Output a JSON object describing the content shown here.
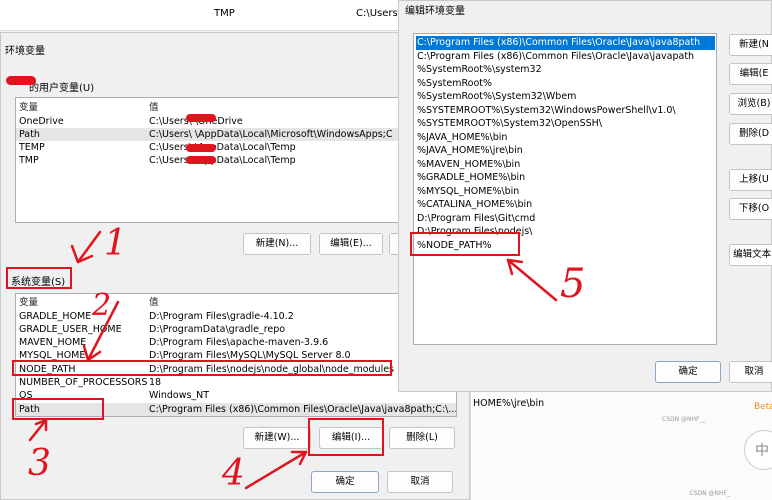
{
  "background": {
    "top_row_value": "TMP",
    "top_row_path": "C:\\Users\\",
    "top_left_text": "环境变量",
    "right_fragment": "HOME%\\jre\\bin",
    "watermark": "CSDN @NHF_",
    "watermark2": "CSDN @NHF__",
    "beta_text": "Beta",
    "circle_text": "中"
  },
  "env_dialog": {
    "title": "环境变量",
    "user_group_label": "的用户变量(U)",
    "columns": {
      "name": "变量",
      "value": "值"
    },
    "user_vars": [
      {
        "name": "OneDrive",
        "value": "C:\\Users\\      \\OneDrive"
      },
      {
        "name": "Path",
        "value": "C:\\Users\\      \\AppData\\Local\\Microsoft\\WindowsApps;C"
      },
      {
        "name": "TEMP",
        "value": "C:\\Users\\      \\AppData\\Local\\Temp"
      },
      {
        "name": "TMP",
        "value": "C:\\Users\\      \\AppData\\Local\\Temp"
      }
    ],
    "user_buttons": {
      "new": "新建(N)...",
      "edit": "编辑(E)..."
    },
    "system_group_label": "系统变量(S)",
    "system_vars": [
      {
        "name": "GRADLE_HOME",
        "value": "D:\\Program Files\\gradle-4.10.2"
      },
      {
        "name": "GRADLE_USER_HOME",
        "value": "D:\\ProgramData\\gradle_repo"
      },
      {
        "name": "MAVEN_HOME",
        "value": "D:\\Program Files\\apache-maven-3.9.6"
      },
      {
        "name": "MYSQL_HOME",
        "value": "D:\\Program Files\\MySQL\\MySQL Server 8.0"
      },
      {
        "name": "NODE_PATH",
        "value": "D:\\Program Files\\nodejs\\node_global\\node_modules"
      },
      {
        "name": "NUMBER_OF_PROCESSORS",
        "value": "18"
      },
      {
        "name": "OS",
        "value": "Windows_NT"
      },
      {
        "name": "Path",
        "value": "C:\\Program Files (x86)\\Common Files\\Oracle\\Java\\java8path;C:\\..."
      }
    ],
    "system_buttons": {
      "new": "新建(W)...",
      "edit": "编辑(I)...",
      "delete": "删除(L)"
    },
    "ok": "确定",
    "cancel": "取消"
  },
  "edit_dialog": {
    "title": "编辑环境变量",
    "items": [
      "C:\\Program Files (x86)\\Common Files\\Oracle\\Java\\java8path",
      "C:\\Program Files (x86)\\Common Files\\Oracle\\Java\\javapath",
      "%SystemRoot%\\system32",
      "%SystemRoot%",
      "%SystemRoot%\\System32\\Wbem",
      "%SYSTEMROOT%\\System32\\WindowsPowerShell\\v1.0\\",
      "%SYSTEMROOT%\\System32\\OpenSSH\\",
      "%JAVA_HOME%\\bin",
      "%JAVA_HOME%\\jre\\bin",
      "%MAVEN_HOME%\\bin",
      "%GRADLE_HOME%\\bin",
      "%MYSQL_HOME%\\bin",
      "%CATALINA_HOME%\\bin",
      "D:\\Program Files\\Git\\cmd",
      "D:\\Program Files\\nodejs\\",
      "%NODE_PATH%"
    ],
    "buttons": {
      "new": "新建(N",
      "edit": "编辑(E",
      "browse": "浏览(B)",
      "delete": "删除(D",
      "move_up": "上移(U",
      "move_down": "下移(O",
      "edit_text": "编辑文本(",
      "ok": "确定",
      "cancel": "取消"
    }
  },
  "annotations": {
    "step1": "1",
    "step2": "2",
    "step3": "3",
    "step4": "4",
    "step5": "5"
  },
  "colors": {
    "annotation": "#e0141e",
    "selection": "#0078d7"
  }
}
